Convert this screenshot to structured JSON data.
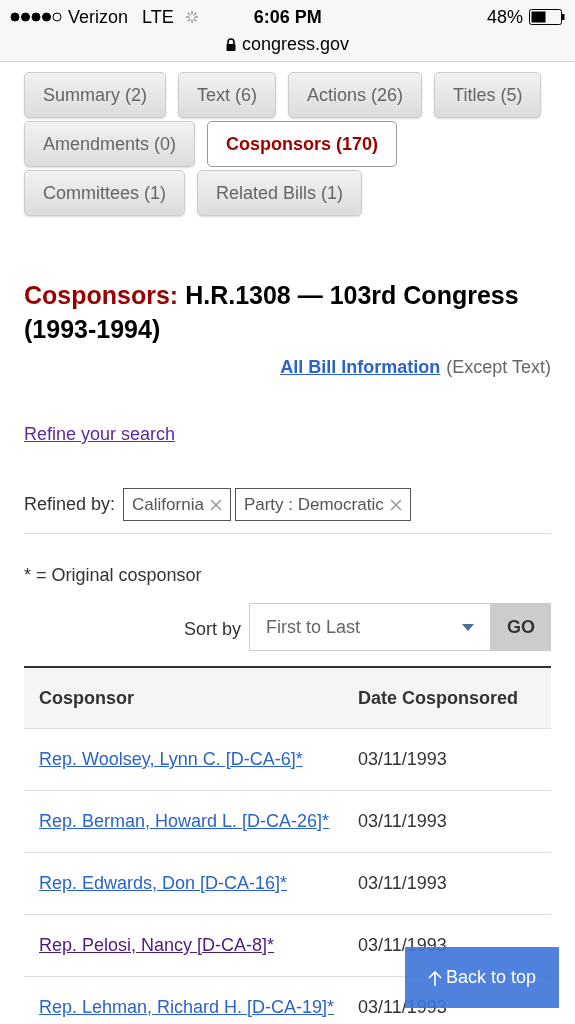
{
  "status_bar": {
    "carrier": "Verizon",
    "network": "LTE",
    "time": "6:06 PM",
    "battery": "48%",
    "url": "congress.gov"
  },
  "tabs": [
    {
      "label": "Summary (2)",
      "selected": false
    },
    {
      "label": "Text (6)",
      "selected": false
    },
    {
      "label": "Actions (26)",
      "selected": false
    },
    {
      "label": "Titles (5)",
      "selected": false
    },
    {
      "label": "Amendments (0)",
      "selected": false
    },
    {
      "label": "Cosponsors (170)",
      "selected": true
    },
    {
      "label": "Committees (1)",
      "selected": false
    },
    {
      "label": "Related Bills (1)",
      "selected": false
    }
  ],
  "heading": {
    "label": "Cosponsors:",
    "title": "H.R.1308 — 103rd Congress (1993-1994)"
  },
  "all_info": {
    "link": "All Bill Information",
    "note": "(Except Text)"
  },
  "refine_link": "Refine your search",
  "refined_by": {
    "label": "Refined by:",
    "filters": [
      "California",
      "Party : Democratic"
    ]
  },
  "legend": "* = Original cosponsor",
  "sort": {
    "label": "Sort by",
    "value": "First to Last",
    "button": "GO"
  },
  "table": {
    "columns": [
      "Cosponsor",
      "Date Cosponsored"
    ],
    "rows": [
      {
        "name": "Rep. Woolsey, Lynn C. [D-CA-6]*",
        "date": "03/11/1993",
        "visited": false
      },
      {
        "name": "Rep. Berman, Howard L. [D-CA-26]*",
        "date": "03/11/1993",
        "visited": false
      },
      {
        "name": "Rep. Edwards, Don [D-CA-16]*",
        "date": "03/11/1993",
        "visited": false
      },
      {
        "name": "Rep. Pelosi, Nancy [D-CA-8]*",
        "date": "03/11/1993",
        "visited": true
      },
      {
        "name": "Rep. Lehman, Richard H. [D-CA-19]*",
        "date": "03/11/1993",
        "visited": false
      }
    ]
  },
  "back_to_top": "Back to top"
}
